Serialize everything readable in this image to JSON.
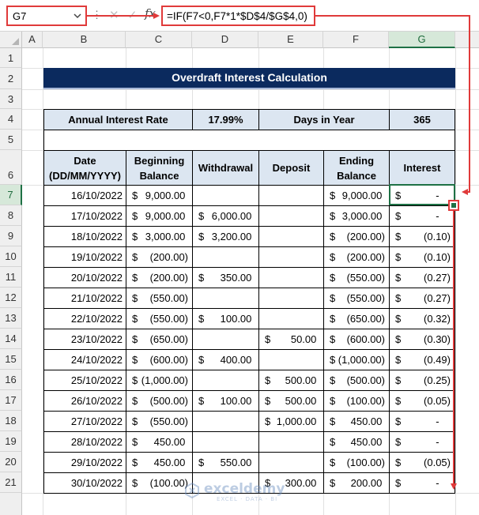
{
  "formula_bar": {
    "name_box": "G7",
    "cancel_icon": "✕",
    "enter_icon": "✓",
    "fx_label": "fx",
    "formula": "=IF(F7<0,F7*1*$D$4/$G$4,0)"
  },
  "columns": [
    "A",
    "B",
    "C",
    "D",
    "E",
    "F",
    "G"
  ],
  "rows": [
    "1",
    "2",
    "3",
    "4",
    "5",
    "6",
    "7",
    "8",
    "9",
    "10",
    "11",
    "12",
    "13",
    "14",
    "15",
    "16",
    "17",
    "18",
    "19",
    "20",
    "21"
  ],
  "sheet": {
    "title": "Overdraft Interest Calculation",
    "annual_rate_label": "Annual Interest Rate",
    "annual_rate_value": "17.99%",
    "days_label": "Days in Year",
    "days_value": "365",
    "headers": {
      "date": "Date (DD/MM/YYYY)",
      "beginning": "Beginning Balance",
      "withdrawal": "Withdrawal",
      "deposit": "Deposit",
      "ending": "Ending Balance",
      "interest": "Interest"
    },
    "currency_symbol": "$",
    "table": [
      {
        "date": "16/10/2022",
        "beginning": "9,000.00 ",
        "withdrawal": "",
        "deposit": "",
        "ending": "9,000.00 ",
        "interest": "-    "
      },
      {
        "date": "17/10/2022",
        "beginning": "9,000.00 ",
        "withdrawal": "6,000.00 ",
        "deposit": "",
        "ending": "3,000.00 ",
        "interest": "-    "
      },
      {
        "date": "18/10/2022",
        "beginning": "3,000.00 ",
        "withdrawal": "3,200.00 ",
        "deposit": "",
        "ending": "(200.00)",
        "interest": "(0.10)"
      },
      {
        "date": "19/10/2022",
        "beginning": "(200.00)",
        "withdrawal": "",
        "deposit": "",
        "ending": "(200.00)",
        "interest": "(0.10)"
      },
      {
        "date": "20/10/2022",
        "beginning": "(200.00)",
        "withdrawal": "350.00 ",
        "deposit": "",
        "ending": "(550.00)",
        "interest": "(0.27)"
      },
      {
        "date": "21/10/2022",
        "beginning": "(550.00)",
        "withdrawal": "",
        "deposit": "",
        "ending": "(550.00)",
        "interest": "(0.27)"
      },
      {
        "date": "22/10/2022",
        "beginning": "(550.00)",
        "withdrawal": "100.00 ",
        "deposit": "",
        "ending": "(650.00)",
        "interest": "(0.32)"
      },
      {
        "date": "23/10/2022",
        "beginning": "(650.00)",
        "withdrawal": "",
        "deposit": "50.00 ",
        "ending": "(600.00)",
        "interest": "(0.30)"
      },
      {
        "date": "24/10/2022",
        "beginning": "(600.00)",
        "withdrawal": "400.00 ",
        "deposit": "",
        "ending": "(1,000.00)",
        "interest": "(0.49)"
      },
      {
        "date": "25/10/2022",
        "beginning": "(1,000.00)",
        "withdrawal": "",
        "deposit": "500.00 ",
        "ending": "(500.00)",
        "interest": "(0.25)"
      },
      {
        "date": "26/10/2022",
        "beginning": "(500.00)",
        "withdrawal": "100.00 ",
        "deposit": "500.00 ",
        "ending": "(100.00)",
        "interest": "(0.05)"
      },
      {
        "date": "27/10/2022",
        "beginning": "(550.00)",
        "withdrawal": "",
        "deposit": "1,000.00 ",
        "ending": "450.00 ",
        "interest": "-    "
      },
      {
        "date": "28/10/2022",
        "beginning": "450.00 ",
        "withdrawal": "",
        "deposit": "",
        "ending": "450.00 ",
        "interest": "-    "
      },
      {
        "date": "29/10/2022",
        "beginning": "450.00 ",
        "withdrawal": "550.00 ",
        "deposit": "",
        "ending": "(100.00)",
        "interest": "(0.05)"
      },
      {
        "date": "30/10/2022",
        "beginning": "(100.00)",
        "withdrawal": "",
        "deposit": "300.00 ",
        "ending": "200.00 ",
        "interest": "-    "
      }
    ]
  },
  "selection": {
    "active_cell": "G7",
    "column": "G",
    "row": "7"
  },
  "colors": {
    "title_bg": "#0b2a5e",
    "header_bg": "#dce6f1",
    "selection": "#1e7145",
    "callout_red": "#e03a3a"
  },
  "watermark": {
    "name": "exceldemy",
    "tagline": "EXCEL · DATA · BI"
  }
}
